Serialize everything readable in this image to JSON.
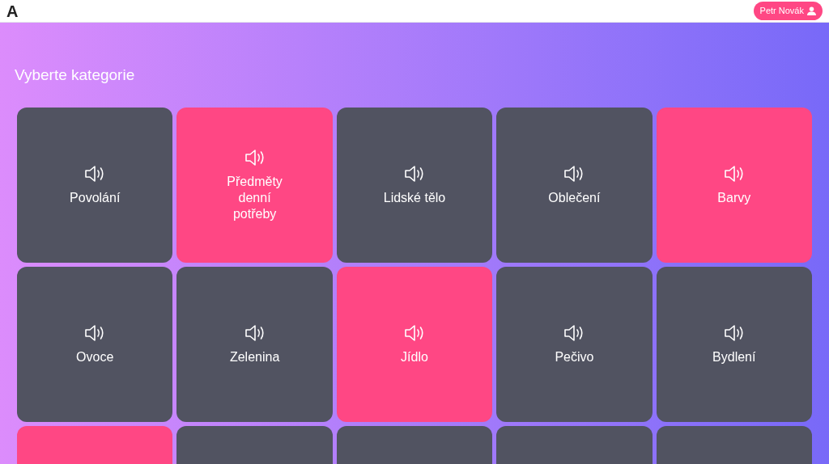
{
  "header": {
    "logo": "A",
    "user": "Petr Novák"
  },
  "title": "Vyberte kategorie",
  "tiles": [
    {
      "label": "Povolání",
      "selected": false
    },
    {
      "label": "Předměty denní potřeby",
      "selected": true
    },
    {
      "label": "Lidské tělo",
      "selected": false
    },
    {
      "label": "Oblečení",
      "selected": false
    },
    {
      "label": "Barvy",
      "selected": true
    },
    {
      "label": "Ovoce",
      "selected": false
    },
    {
      "label": "Zelenina",
      "selected": false
    },
    {
      "label": "Jídlo",
      "selected": true
    },
    {
      "label": "Pečivo",
      "selected": false
    },
    {
      "label": "Bydlení",
      "selected": false
    },
    {
      "selected": true
    },
    {
      "selected": false
    },
    {
      "selected": false
    },
    {
      "selected": false
    },
    {
      "selected": false
    }
  ]
}
